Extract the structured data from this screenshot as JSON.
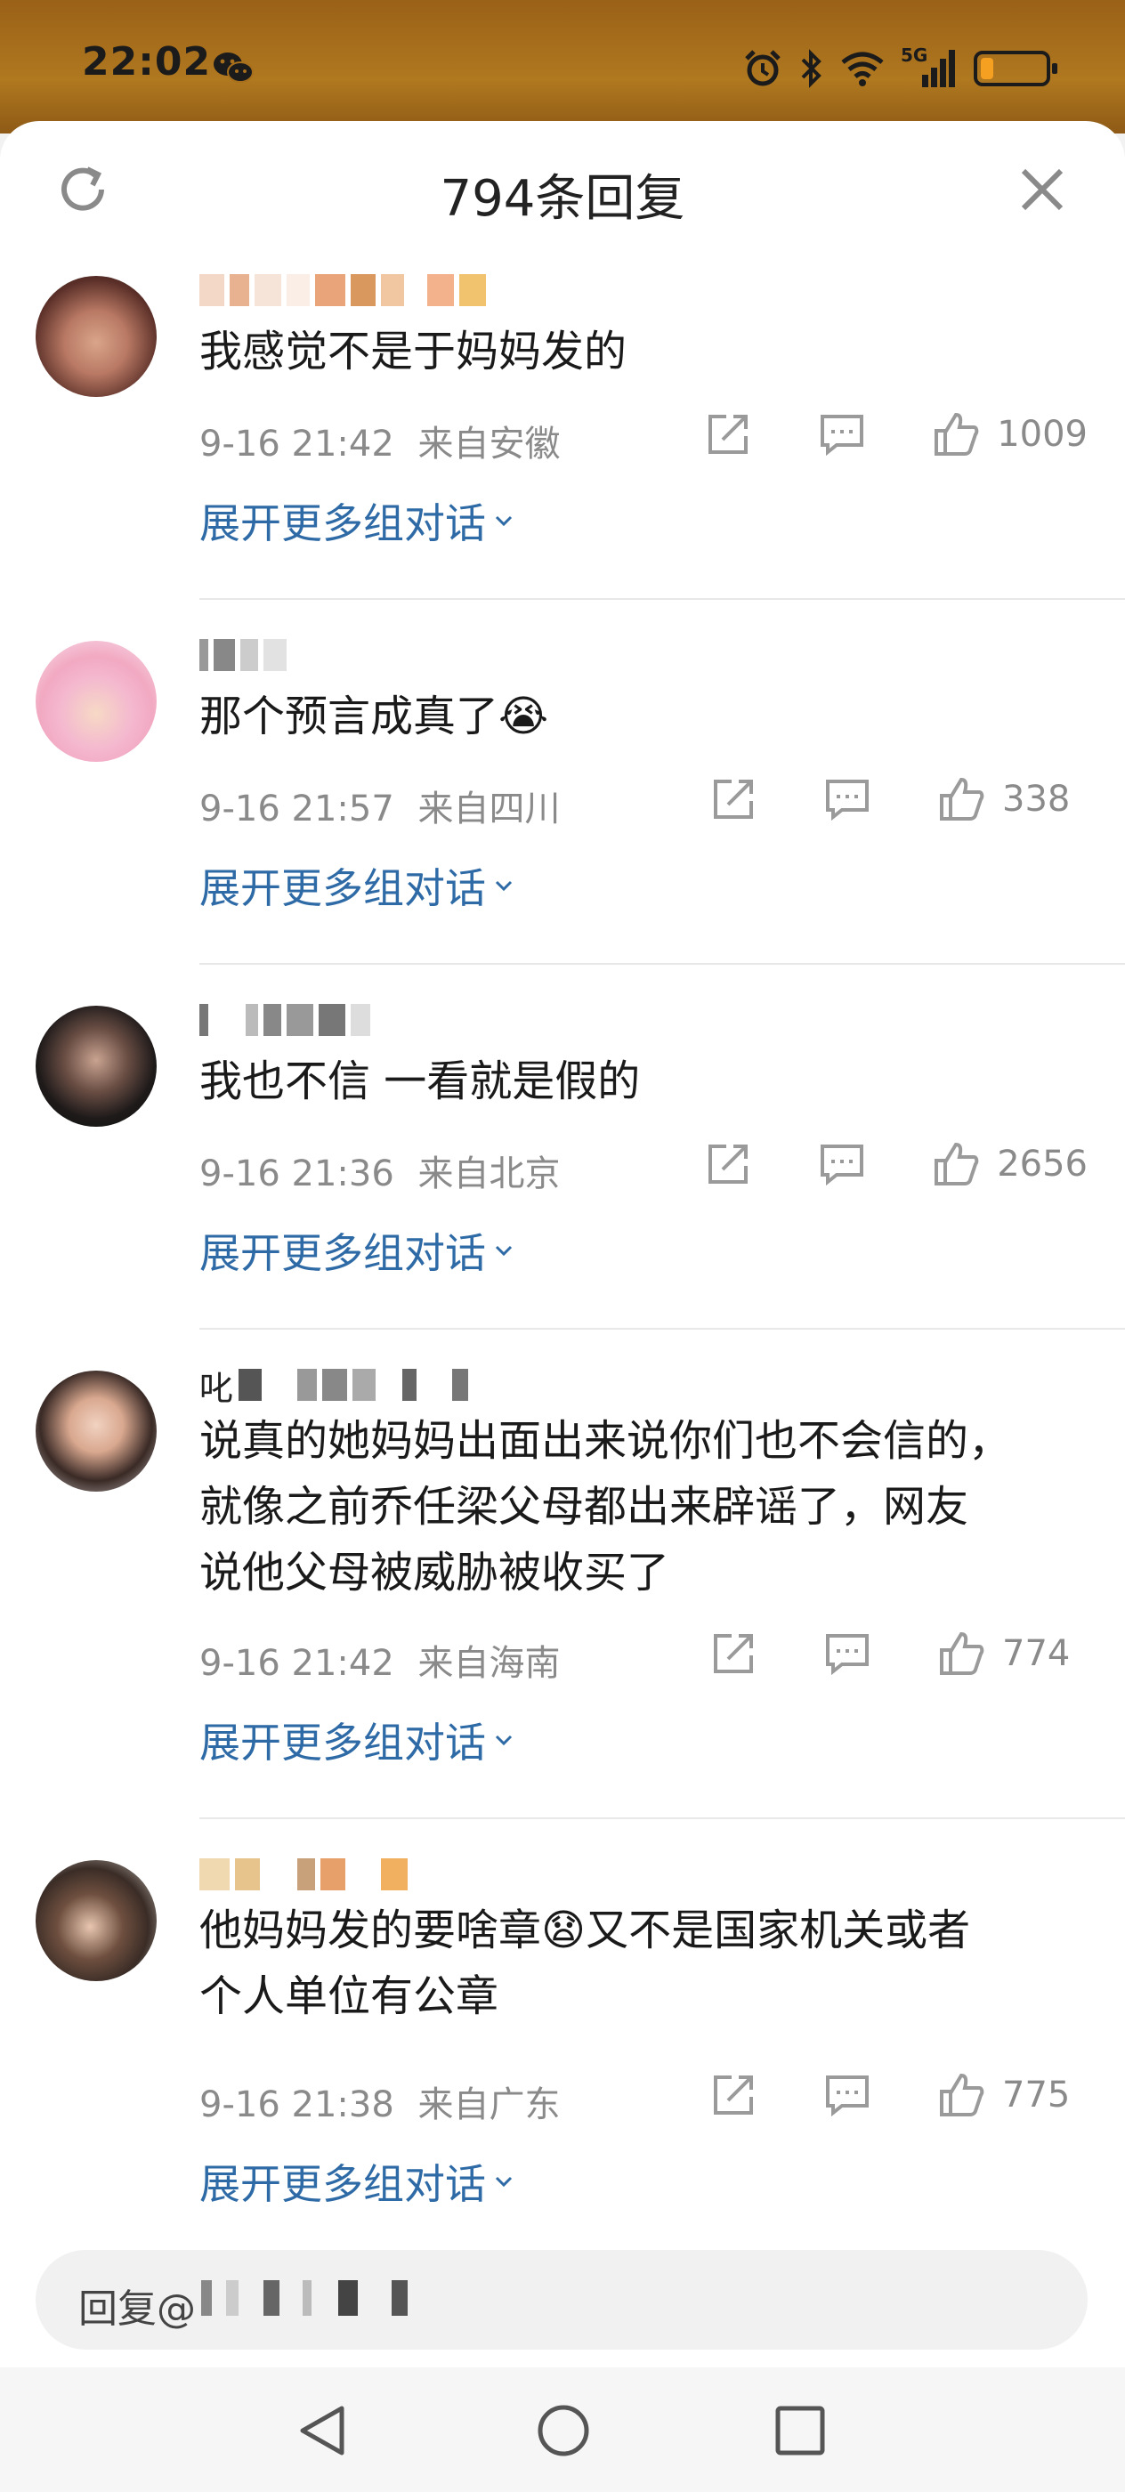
{
  "status_bar": {
    "time": "22:02",
    "network": "5G",
    "battery_level": 0.2,
    "icons": [
      "wechat-icon",
      "alarm-icon",
      "bluetooth-icon",
      "wifi-icon",
      "signal-icon",
      "battery-icon"
    ]
  },
  "header": {
    "title": "794条回复",
    "refresh_icon": "refresh-icon",
    "close_icon": "close-icon"
  },
  "colors": {
    "link": "#2e6aa6",
    "meta": "#8a8a8a",
    "status_bar": "#a86f1c"
  },
  "comments": [
    {
      "text": "我感觉不是于妈妈发的",
      "time": "9-16 21:42",
      "location": "来自安徽",
      "likes": "1009",
      "expand": "展开更多组对话"
    },
    {
      "text": "那个预言成真了",
      "emoji": "😭",
      "time": "9-16 21:57",
      "location": "来自四川",
      "likes": "338",
      "expand": "展开更多组对话"
    },
    {
      "text": "我也不信 一看就是假的",
      "time": "9-16 21:36",
      "location": "来自北京",
      "likes": "2656",
      "expand": "展开更多组对话"
    },
    {
      "name_prefix": "叱",
      "text_lines": [
        "说真的她妈妈出面出来说你们也不会信的，",
        "就像之前乔任梁父母都出来辟谣了，网友",
        "说他父母被威胁被收买了"
      ],
      "time": "9-16 21:42",
      "location": "来自海南",
      "likes": "774",
      "expand": "展开更多组对话"
    },
    {
      "text_lines": [
        "他妈妈发的要啥章",
        "又不是国家机关或者",
        "个人单位有公章"
      ],
      "emoji": "😧",
      "time": "9-16 21:38",
      "location": "来自广东",
      "likes": "775",
      "expand": "展开更多组对话"
    }
  ],
  "reply_bar": {
    "prefix": "回复@"
  },
  "nav": {
    "icons": [
      "back-triangle-icon",
      "home-circle-icon",
      "recents-square-icon"
    ]
  }
}
